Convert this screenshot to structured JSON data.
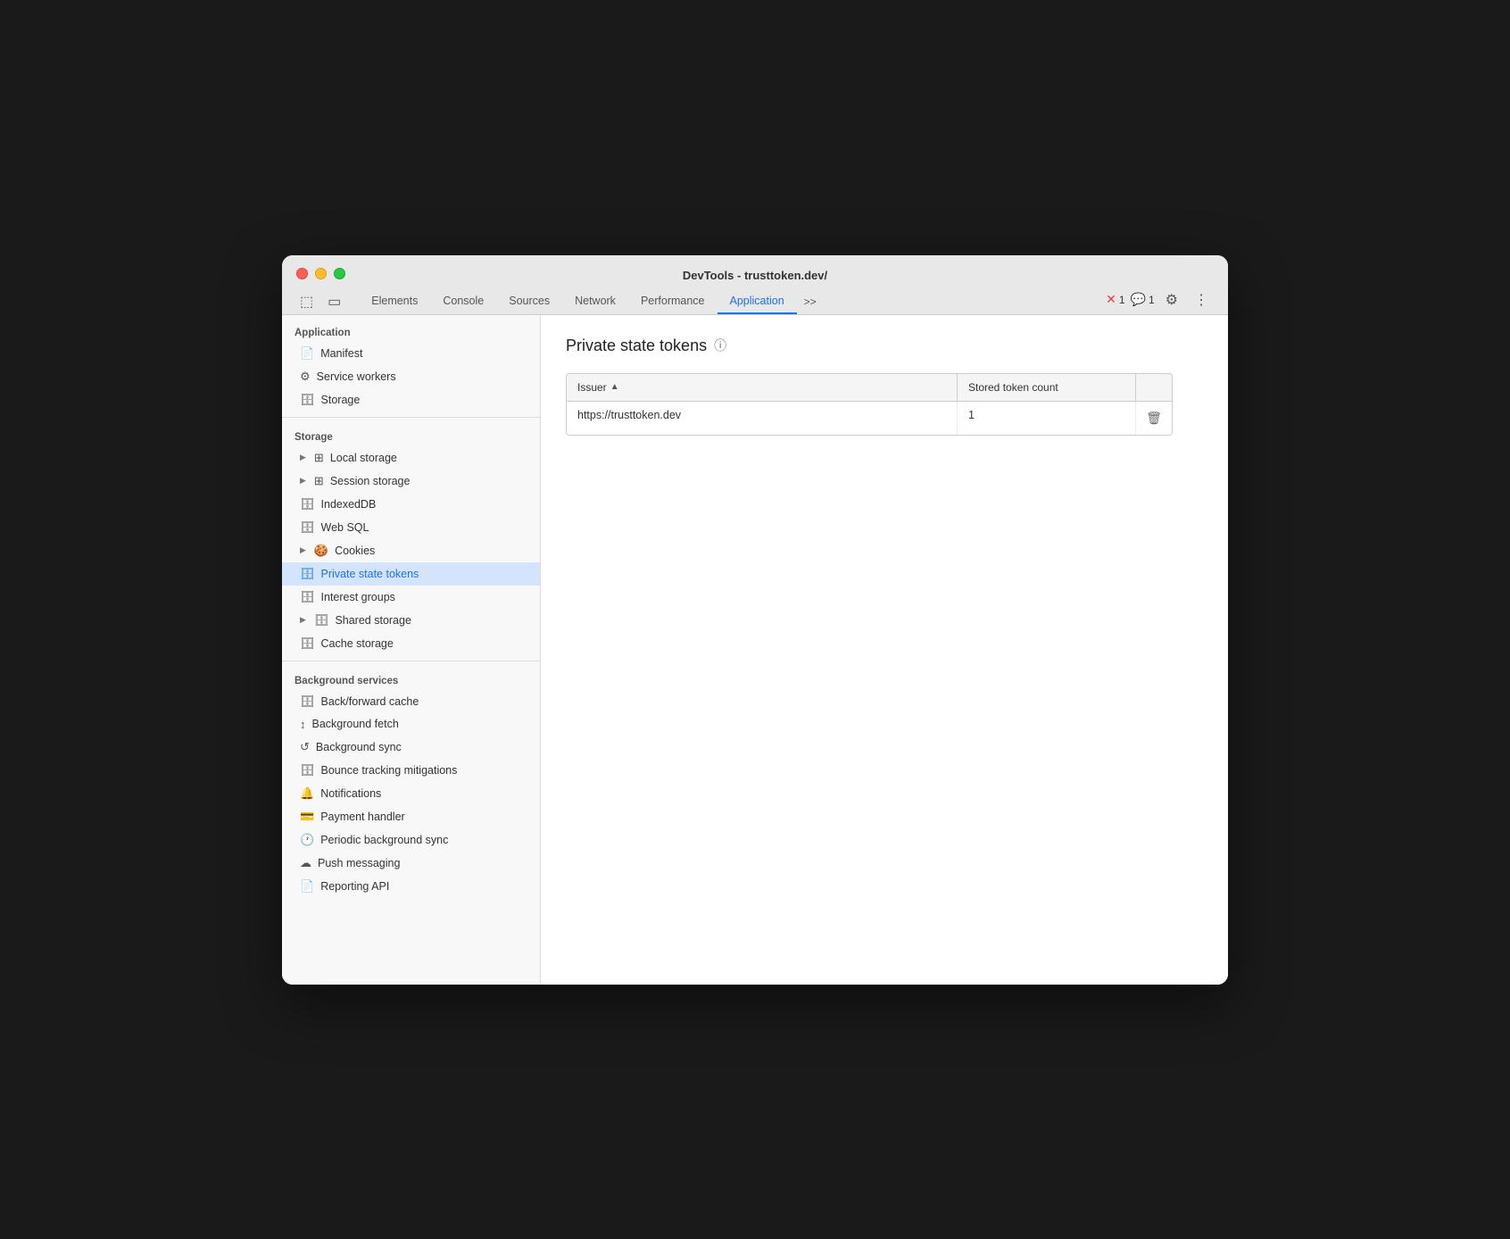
{
  "window": {
    "title": "DevTools - trusttoken.dev/"
  },
  "tabs": {
    "items": [
      {
        "label": "Elements",
        "active": false
      },
      {
        "label": "Console",
        "active": false
      },
      {
        "label": "Sources",
        "active": false
      },
      {
        "label": "Network",
        "active": false
      },
      {
        "label": "Performance",
        "active": false
      },
      {
        "label": "Application",
        "active": true
      }
    ],
    "more_label": ">>",
    "error_count": "1",
    "warn_count": "1"
  },
  "sidebar": {
    "application_section": "Application",
    "application_items": [
      {
        "label": "Manifest",
        "icon": "📄",
        "indent": false,
        "expandable": false
      },
      {
        "label": "Service workers",
        "icon": "⚙",
        "indent": false,
        "expandable": false
      },
      {
        "label": "Storage",
        "icon": "🗄",
        "indent": false,
        "expandable": false
      }
    ],
    "storage_section": "Storage",
    "storage_items": [
      {
        "label": "Local storage",
        "icon": "⊞",
        "expandable": true
      },
      {
        "label": "Session storage",
        "icon": "⊞",
        "expandable": true
      },
      {
        "label": "IndexedDB",
        "icon": "🗄",
        "expandable": false
      },
      {
        "label": "Web SQL",
        "icon": "🗄",
        "expandable": false
      },
      {
        "label": "Cookies",
        "icon": "🍪",
        "expandable": true
      },
      {
        "label": "Private state tokens",
        "icon": "🗄",
        "expandable": false,
        "active": true
      },
      {
        "label": "Interest groups",
        "icon": "🗄",
        "expandable": false
      },
      {
        "label": "Shared storage",
        "icon": "🗄",
        "expandable": true
      },
      {
        "label": "Cache storage",
        "icon": "🗄",
        "expandable": false
      }
    ],
    "background_section": "Background services",
    "background_items": [
      {
        "label": "Back/forward cache",
        "icon": "🗄",
        "expandable": false
      },
      {
        "label": "Background fetch",
        "icon": "↕",
        "expandable": false
      },
      {
        "label": "Background sync",
        "icon": "↺",
        "expandable": false
      },
      {
        "label": "Bounce tracking mitigations",
        "icon": "🗄",
        "expandable": false
      },
      {
        "label": "Notifications",
        "icon": "🔔",
        "expandable": false
      },
      {
        "label": "Payment handler",
        "icon": "💳",
        "expandable": false
      },
      {
        "label": "Periodic background sync",
        "icon": "🕐",
        "expandable": false
      },
      {
        "label": "Push messaging",
        "icon": "☁",
        "expandable": false
      },
      {
        "label": "Reporting API",
        "icon": "📄",
        "expandable": false
      }
    ]
  },
  "main": {
    "page_title": "Private state tokens",
    "table": {
      "col_issuer": "Issuer",
      "col_token_count": "Stored token count",
      "rows": [
        {
          "issuer": "https://trusttoken.dev",
          "token_count": "1"
        }
      ]
    }
  }
}
